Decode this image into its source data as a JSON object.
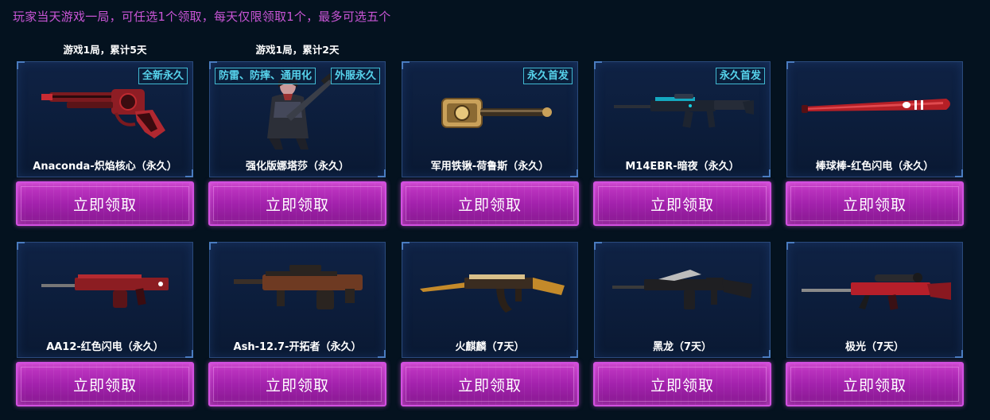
{
  "intro": "玩家当天游戏一局，可任选1个领取，每天仅限领取1个，最多可选五个",
  "requirements": [
    "游戏1局，累计5天",
    "游戏1局，累计2天"
  ],
  "claim_label": "立即领取",
  "items": [
    {
      "name": "Anaconda-炽焰核心（永久）",
      "badges_right": [
        "全新永久"
      ],
      "icon": "revolver-icon"
    },
    {
      "name": "强化版娜塔莎（永久）",
      "badge_left": "防雷、防摔、通用化",
      "badges_right": [
        "外服永久"
      ],
      "icon": "character-icon"
    },
    {
      "name": "军用铁锹-荷鲁斯（永久）",
      "badges_right": [
        "永久首发"
      ],
      "icon": "shovel-icon"
    },
    {
      "name": "M14EBR-暗夜（永久）",
      "badges_right": [
        "永久首发"
      ],
      "icon": "rifle-icon"
    },
    {
      "name": "棒球棒-红色闪电（永久）",
      "badges_right": [],
      "icon": "baseball-bat-icon"
    },
    {
      "name": "AA12-红色闪电（永久）",
      "badges_right": [],
      "icon": "shotgun-icon"
    },
    {
      "name": "Ash-12.7-开拓者（永久）",
      "badges_right": [],
      "icon": "assault-rifle-icon"
    },
    {
      "name": "火麒麟（7天）",
      "badges_right": [],
      "icon": "ak-rifle-icon"
    },
    {
      "name": "黑龙（7天）",
      "badges_right": [],
      "icon": "m4-rifle-icon"
    },
    {
      "name": "极光（7天）",
      "badges_right": [],
      "icon": "sniper-rifle-icon"
    }
  ],
  "colors": {
    "intro": "#c955d6",
    "badge": "#57d3ec",
    "button": "#b02cb8",
    "card": "#0f2244"
  }
}
